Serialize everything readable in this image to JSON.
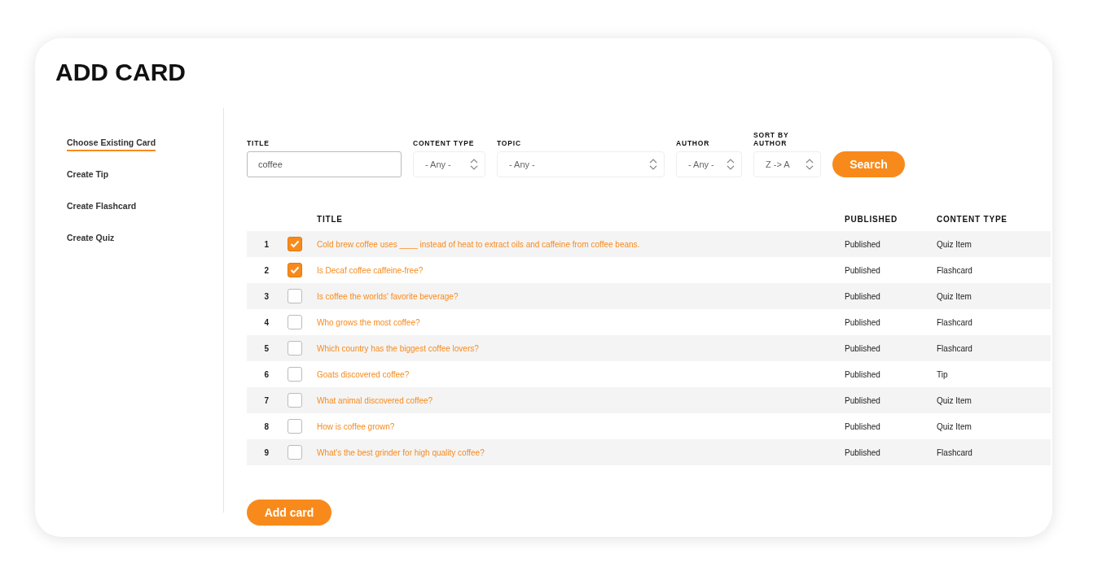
{
  "title": "ADD CARD",
  "sidebar": {
    "items": [
      {
        "label": "Choose Existing Card",
        "selected": true
      },
      {
        "label": "Create Tip",
        "selected": false
      },
      {
        "label": "Create Flashcard",
        "selected": false
      },
      {
        "label": "Create Quiz",
        "selected": false
      }
    ]
  },
  "filters": [
    {
      "kind": "text",
      "label": "TITLE",
      "value": "coffee"
    },
    {
      "kind": "select",
      "label": "CONTENT TYPE",
      "value": "- Any -"
    },
    {
      "kind": "select",
      "label": "TOPIC",
      "value": "- Any -"
    },
    {
      "kind": "select",
      "label": "AUTHOR",
      "value": "- Any -"
    },
    {
      "kind": "select",
      "label": "SORT BY AUTHOR",
      "value": "Z -> A"
    }
  ],
  "search_button": "Search",
  "table": {
    "columns": [
      "TITLE",
      "PUBLISHED",
      "CONTENT TYPE"
    ],
    "rows": [
      {
        "number": "1",
        "checked": true,
        "title": "Cold brew coffee uses ____ instead of heat to extract oils and caffeine from coffee beans.",
        "published": "Published",
        "content_type": "Quiz Item"
      },
      {
        "number": "2",
        "checked": true,
        "title": "Is Decaf coffee caffeine-free?",
        "published": "Published",
        "content_type": "Flashcard"
      },
      {
        "number": "3",
        "checked": false,
        "title": "Is coffee the worlds' favorite beverage?",
        "published": "Published",
        "content_type": "Quiz Item"
      },
      {
        "number": "4",
        "checked": false,
        "title": "Who grows the most coffee?",
        "published": "Published",
        "content_type": "Flashcard"
      },
      {
        "number": "5",
        "checked": false,
        "title": "Which country has the biggest coffee lovers?",
        "published": "Published",
        "content_type": "Flashcard"
      },
      {
        "number": "6",
        "checked": false,
        "title": "Goats discovered coffee?",
        "published": "Published",
        "content_type": "Tip"
      },
      {
        "number": "7",
        "checked": false,
        "title": "What animal discovered coffee?",
        "published": "Published",
        "content_type": "Quiz Item"
      },
      {
        "number": "8",
        "checked": false,
        "title": "How is coffee grown?",
        "published": "Published",
        "content_type": "Quiz Item"
      },
      {
        "number": "9",
        "checked": false,
        "title": "What's the best grinder for high quality coffee?",
        "published": "Published",
        "content_type": "Flashcard"
      }
    ]
  },
  "add_button": "Add card"
}
